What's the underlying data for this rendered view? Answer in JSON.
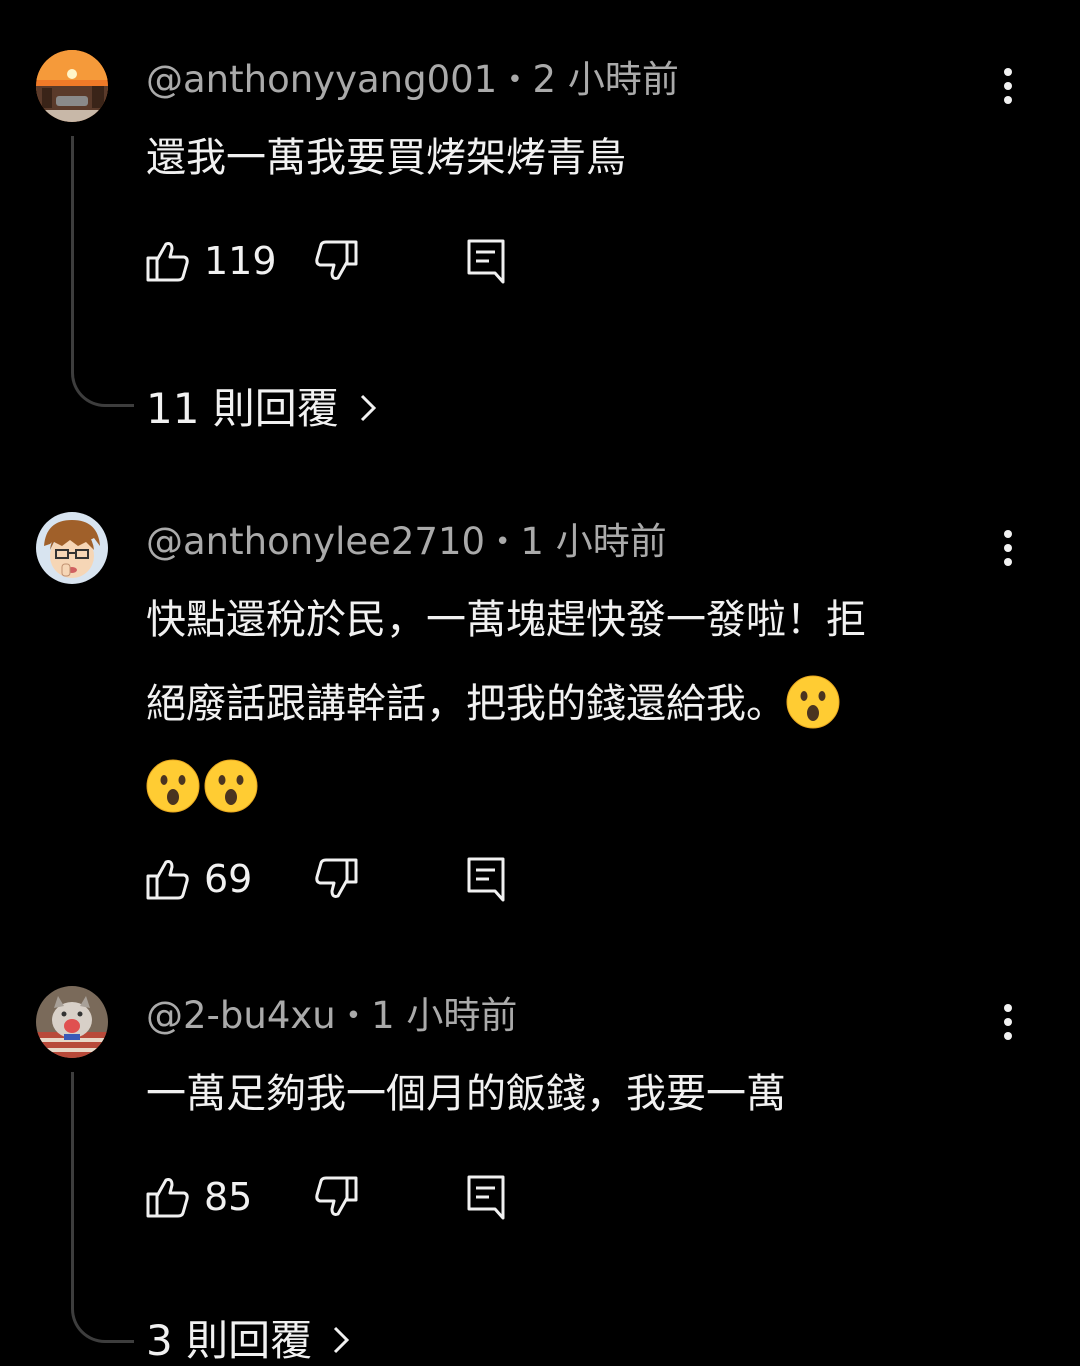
{
  "comments": [
    {
      "author": "@anthonyyang001",
      "time": "2 小時前",
      "text": "還我一萬我要買烤架烤青鳥",
      "likes": "119",
      "replies": "11 則回覆"
    },
    {
      "author": "@anthonylee2710",
      "time": "1 小時前",
      "text_line1": "快點還稅於民，一萬塊趕快發一發啦！拒",
      "text_line2": "絕廢話跟講幹話，把我的錢還給我。",
      "likes": "69"
    },
    {
      "author": "@2-bu4xu",
      "time": "1 小時前",
      "text": "一萬足夠我一個月的飯錢，我要一萬",
      "likes": "85",
      "replies": "3 則回覆"
    }
  ],
  "separator": "•",
  "icons": {
    "like": "thumbs-up-icon",
    "dislike": "thumbs-down-icon",
    "reply": "reply-comment-icon",
    "more": "more-vertical-icon",
    "chevron": "chevron-right-icon",
    "emoji": "hushed-face-emoji"
  },
  "colors": {
    "background": "#000000",
    "text": "#f1f1f1",
    "meta": "#aaaaaa",
    "thread_line": "#3d3d3d",
    "emoji": "#ffcc33"
  }
}
